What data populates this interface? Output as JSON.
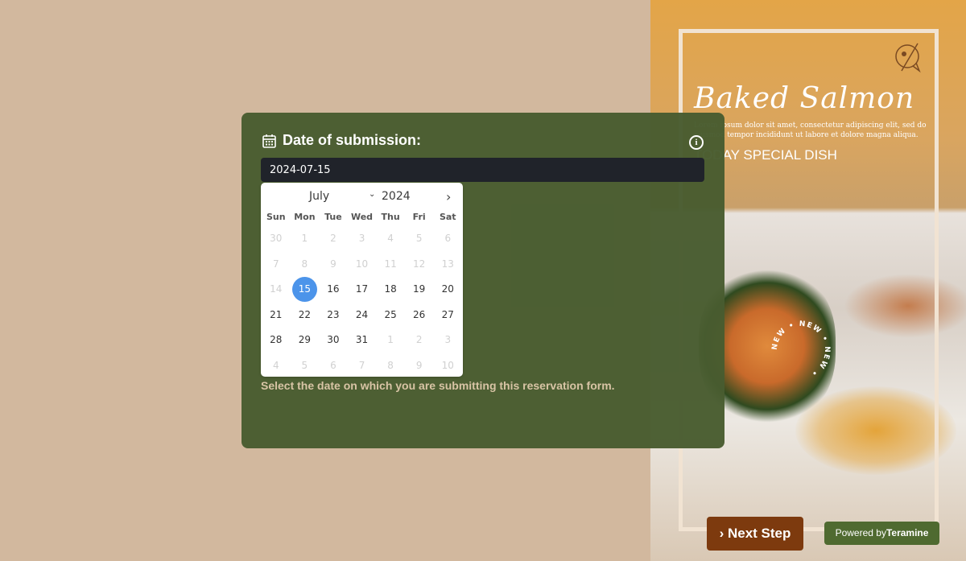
{
  "hero": {
    "title": "Baked Salmon",
    "description": "Lorem ipsum dolor sit amet, consectetur adipiscing elit, sed do eiusmod tempor incididunt ut labore et dolore magna aliqua.",
    "tagline": "TODAY SPECIAL DISH",
    "badge_text": "NEW • NEW • NEW •"
  },
  "form": {
    "label": "Date of submission:",
    "value": "2024-07-15",
    "help": "Select the date on which you are submitting this reservation form."
  },
  "calendar": {
    "month": "July",
    "year": "2024",
    "weekdays": [
      "Sun",
      "Mon",
      "Tue",
      "Wed",
      "Thu",
      "Fri",
      "Sat"
    ],
    "weeks": [
      [
        "30",
        "1",
        "2",
        "3",
        "4",
        "5",
        "6"
      ],
      [
        "7",
        "8",
        "9",
        "10",
        "11",
        "12",
        "13"
      ],
      [
        "14",
        "15",
        "16",
        "17",
        "18",
        "19",
        "20"
      ],
      [
        "21",
        "22",
        "23",
        "24",
        "25",
        "26",
        "27"
      ],
      [
        "28",
        "29",
        "30",
        "31",
        "1",
        "2",
        "3"
      ],
      [
        "4",
        "5",
        "6",
        "7",
        "8",
        "9",
        "10"
      ]
    ],
    "selected": "15",
    "accent": "#4c94ea"
  },
  "footer": {
    "next_label": "Next Step",
    "powered_prefix": "Powered by",
    "powered_brand": "Teramine"
  },
  "colors": {
    "panel": "#485c30",
    "button": "#7d3a0e",
    "background": "#d2b89e"
  }
}
